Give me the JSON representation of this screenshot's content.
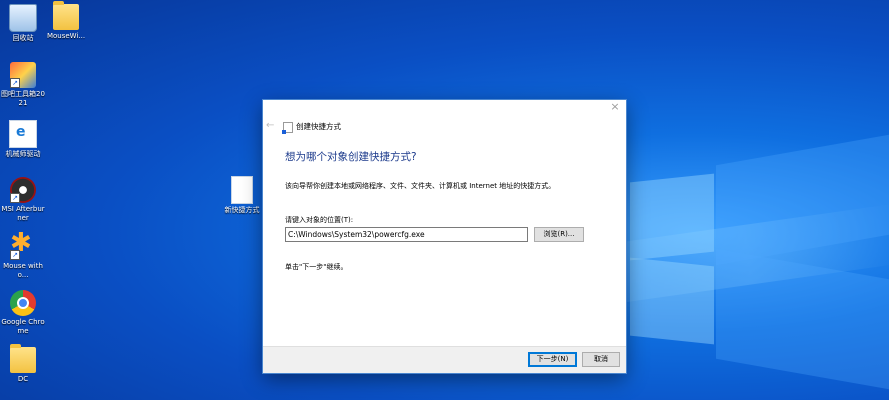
{
  "desktop": {
    "icons": [
      {
        "label": "回收站",
        "icon": "recycle-bin-icon"
      },
      {
        "label": "MouseWi...",
        "icon": "folder-icon"
      },
      {
        "label": "图吧工具箱2021",
        "icon": "toolbox-icon"
      },
      {
        "label": "机械师驱动",
        "icon": "edge-doc-icon"
      },
      {
        "label": "MSI Afterburner",
        "icon": "msi-afterburner-icon"
      },
      {
        "label": "Mouse witho...",
        "icon": "mouse-app-icon"
      },
      {
        "label": "Google Chrome",
        "icon": "chrome-icon"
      },
      {
        "label": "DC",
        "icon": "folder-icon"
      },
      {
        "label": "新快捷方式",
        "icon": "blank-document-icon"
      }
    ]
  },
  "dialog": {
    "close_glyph": "×",
    "back_glyph": "←",
    "wizard_title": "创建快捷方式",
    "heading": "想为哪个对象创建快捷方式?",
    "description": "该向导帮你创建本地或网络程序、文件、文件夹、计算机或 Internet 地址的快捷方式。",
    "location_label": "请键入对象的位置(T):",
    "location_value": "C:\\Windows\\System32\\powercfg.exe",
    "browse_label": "浏览(R)...",
    "hint": "单击\"下一步\"继续。",
    "next_label": "下一步(N)",
    "cancel_label": "取消"
  }
}
